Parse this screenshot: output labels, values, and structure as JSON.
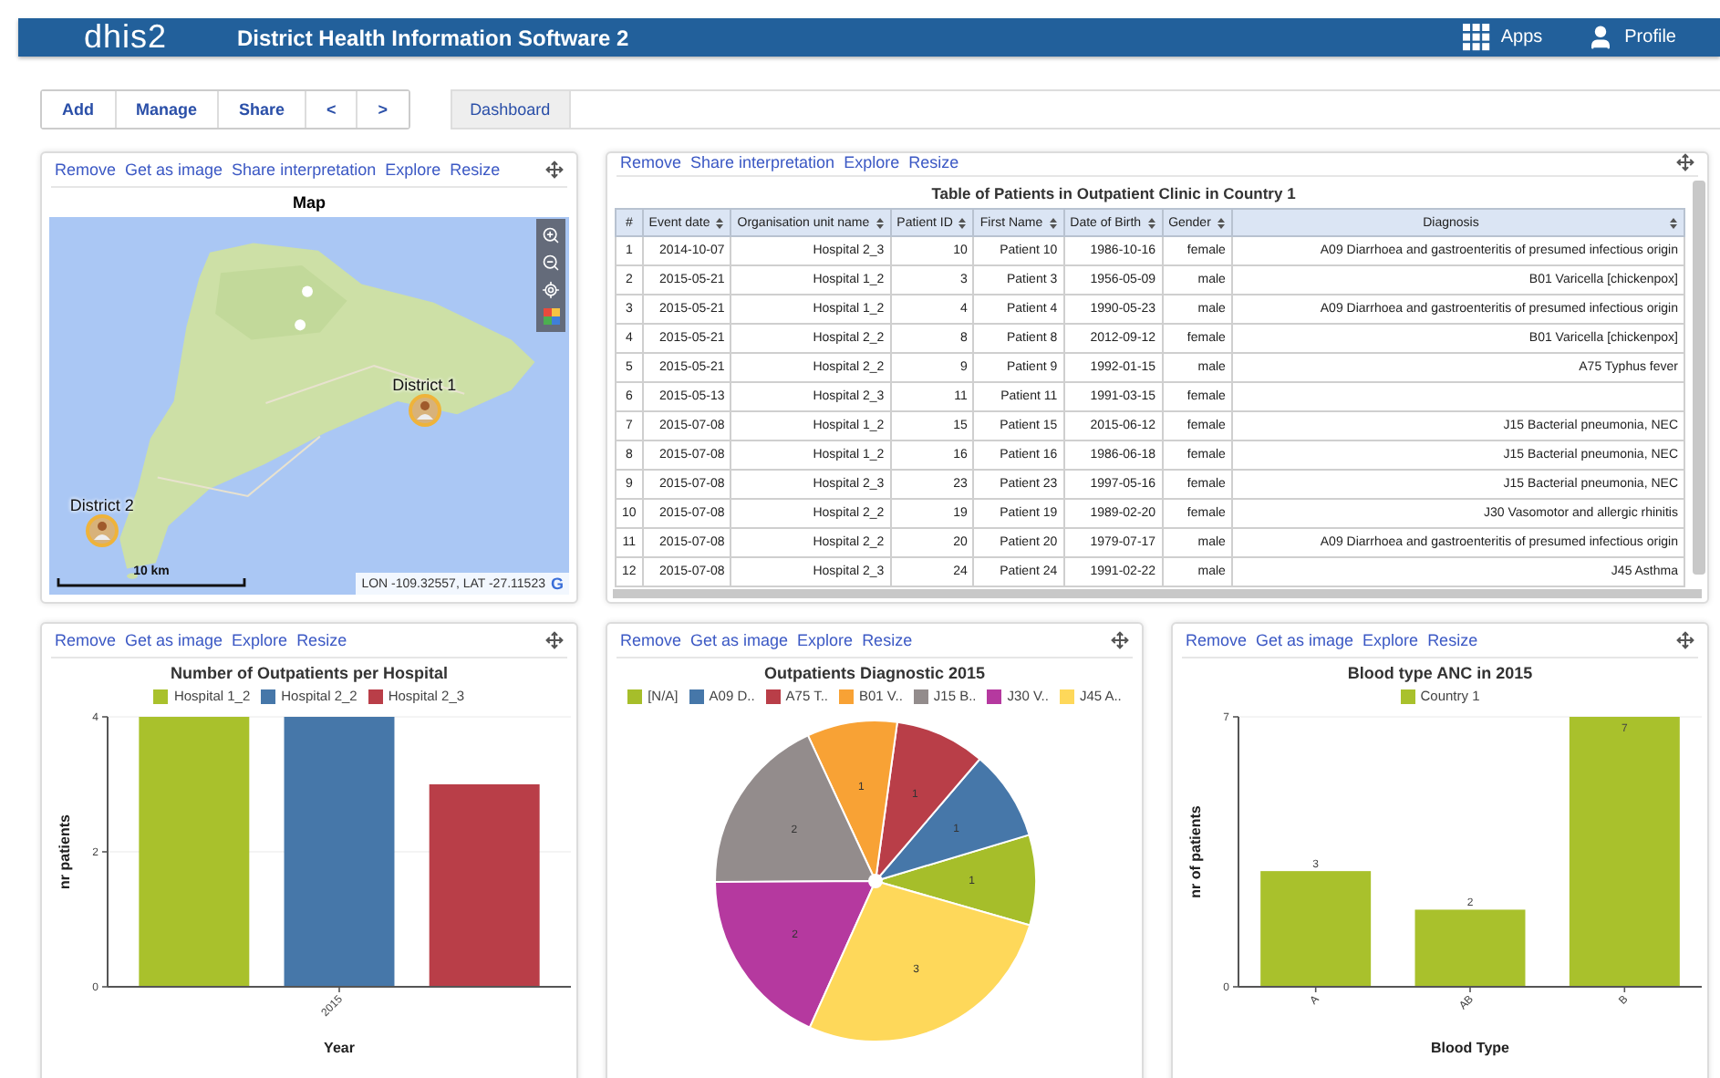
{
  "header": {
    "logo": "dhis2",
    "title": "District Health Information Software 2",
    "menu": [
      {
        "kind": "apps",
        "label": "Apps"
      },
      {
        "kind": "profile",
        "label": "Profile"
      }
    ]
  },
  "toolbar": {
    "buttons": [
      "Add",
      "Manage",
      "Share",
      "<",
      ">"
    ],
    "tabs": [
      {
        "label": "Dashboard",
        "selected": true
      }
    ]
  },
  "widgets": [
    {
      "kind": "map",
      "actions": [
        "Remove",
        "Get as image",
        "Share interpretation",
        "Explore",
        "Resize"
      ],
      "title": "Map",
      "markers": [
        {
          "label": "District 1"
        },
        {
          "label": "District 2"
        }
      ],
      "scale": "10 km",
      "coordinates": "LON -109.32557, LAT -27.11523",
      "attribution": "G"
    },
    {
      "kind": "table",
      "actions": [
        "Remove",
        "Share interpretation",
        "Explore",
        "Resize"
      ],
      "title": "Table of Patients in Outpatient Clinic in Country 1",
      "columns": [
        {
          "label": "#",
          "sortable": false
        },
        {
          "label": "Event date",
          "sortable": true
        },
        {
          "label": "Organisation unit name",
          "sortable": true
        },
        {
          "label": "Patient ID",
          "sortable": true
        },
        {
          "label": "First Name",
          "sortable": true
        },
        {
          "label": "Date of Birth",
          "sortable": true
        },
        {
          "label": "Gender",
          "sortable": true
        },
        {
          "label": "Diagnosis",
          "sortable": true
        }
      ],
      "rows": [
        [
          "1",
          "2014-10-07",
          "Hospital 2_3",
          "10",
          "Patient 10",
          "1986-10-16",
          "female",
          "A09 Diarrhoea and gastroenteritis of presumed infectious origin"
        ],
        [
          "2",
          "2015-05-21",
          "Hospital 1_2",
          "3",
          "Patient 3",
          "1956-05-09",
          "male",
          "B01 Varicella [chickenpox]"
        ],
        [
          "3",
          "2015-05-21",
          "Hospital 1_2",
          "4",
          "Patient 4",
          "1990-05-23",
          "male",
          "A09 Diarrhoea and gastroenteritis of presumed infectious origin"
        ],
        [
          "4",
          "2015-05-21",
          "Hospital 2_2",
          "8",
          "Patient 8",
          "2012-09-12",
          "female",
          "B01 Varicella [chickenpox]"
        ],
        [
          "5",
          "2015-05-21",
          "Hospital 2_2",
          "9",
          "Patient 9",
          "1992-01-15",
          "male",
          "A75 Typhus fever"
        ],
        [
          "6",
          "2015-05-13",
          "Hospital 2_3",
          "11",
          "Patient 11",
          "1991-03-15",
          "female",
          ""
        ],
        [
          "7",
          "2015-07-08",
          "Hospital 1_2",
          "15",
          "Patient 15",
          "2015-06-12",
          "female",
          "J15 Bacterial pneumonia, NEC"
        ],
        [
          "8",
          "2015-07-08",
          "Hospital 1_2",
          "16",
          "Patient 16",
          "1986-06-18",
          "female",
          "J15 Bacterial pneumonia, NEC"
        ],
        [
          "9",
          "2015-07-08",
          "Hospital 2_3",
          "23",
          "Patient 23",
          "1997-05-16",
          "female",
          "J15 Bacterial pneumonia, NEC"
        ],
        [
          "10",
          "2015-07-08",
          "Hospital 2_2",
          "19",
          "Patient 19",
          "1989-02-20",
          "female",
          "J30 Vasomotor and allergic rhinitis"
        ],
        [
          "11",
          "2015-07-08",
          "Hospital 2_2",
          "20",
          "Patient 20",
          "1979-07-17",
          "male",
          "A09 Diarrhoea and gastroenteritis of presumed infectious origin"
        ],
        [
          "12",
          "2015-07-08",
          "Hospital 2_3",
          "24",
          "Patient 24",
          "1991-02-22",
          "male",
          "J45 Asthma"
        ]
      ]
    },
    {
      "kind": "chart",
      "actions": [
        "Remove",
        "Get as image",
        "Explore",
        "Resize"
      ],
      "chart_data": {
        "type": "bar",
        "title": "Number of Outpatients per Hospital",
        "xlabel": "Year",
        "ylabel": "nr patients",
        "categories": [
          "2015"
        ],
        "series": [
          {
            "name": "Hospital 1_2",
            "color": "#a9c12c",
            "values": [
              4
            ]
          },
          {
            "name": "Hospital 2_2",
            "color": "#4677a9",
            "values": [
              4
            ]
          },
          {
            "name": "Hospital 2_3",
            "color": "#b93e48",
            "values": [
              3
            ]
          }
        ],
        "ylim": [
          0,
          4
        ],
        "yticks": [
          0,
          2,
          4
        ]
      }
    },
    {
      "kind": "chart",
      "actions": [
        "Remove",
        "Get as image",
        "Explore",
        "Resize"
      ],
      "legend": [
        {
          "color": "#a6be2a"
        },
        {
          "color": "#4677a9"
        },
        {
          "color": "#b93e48"
        },
        {
          "color": "#f8a235"
        },
        {
          "color": "#938c8c"
        },
        {
          "color": "#b5399f"
        },
        {
          "color": "#fed85a"
        }
      ],
      "chart_data": {
        "type": "pie",
        "title": "Outpatients Diagnostic 2015",
        "categories": [
          "[N/A]",
          "A09 D..",
          "A75 T..",
          "B01 V..",
          "J15 B..",
          "J30 V..",
          "J45 A.."
        ],
        "values": [
          1,
          1,
          1,
          1,
          2,
          2,
          3
        ],
        "data_labels": true
      }
    },
    {
      "kind": "chart",
      "actions": [
        "Remove",
        "Get as image",
        "Explore",
        "Resize"
      ],
      "chart_data": {
        "type": "bar",
        "title": "Blood type ANC in 2015",
        "xlabel": "Blood Type",
        "ylabel": "nr of patients",
        "categories": [
          "A",
          "AB",
          "B"
        ],
        "series": [
          {
            "name": "Country 1",
            "color": "#a9c12c",
            "values": [
              3,
              2,
              7
            ]
          }
        ],
        "ylim": [
          0,
          7
        ],
        "yticks": [
          0,
          7
        ],
        "data_labels": true
      }
    }
  ]
}
